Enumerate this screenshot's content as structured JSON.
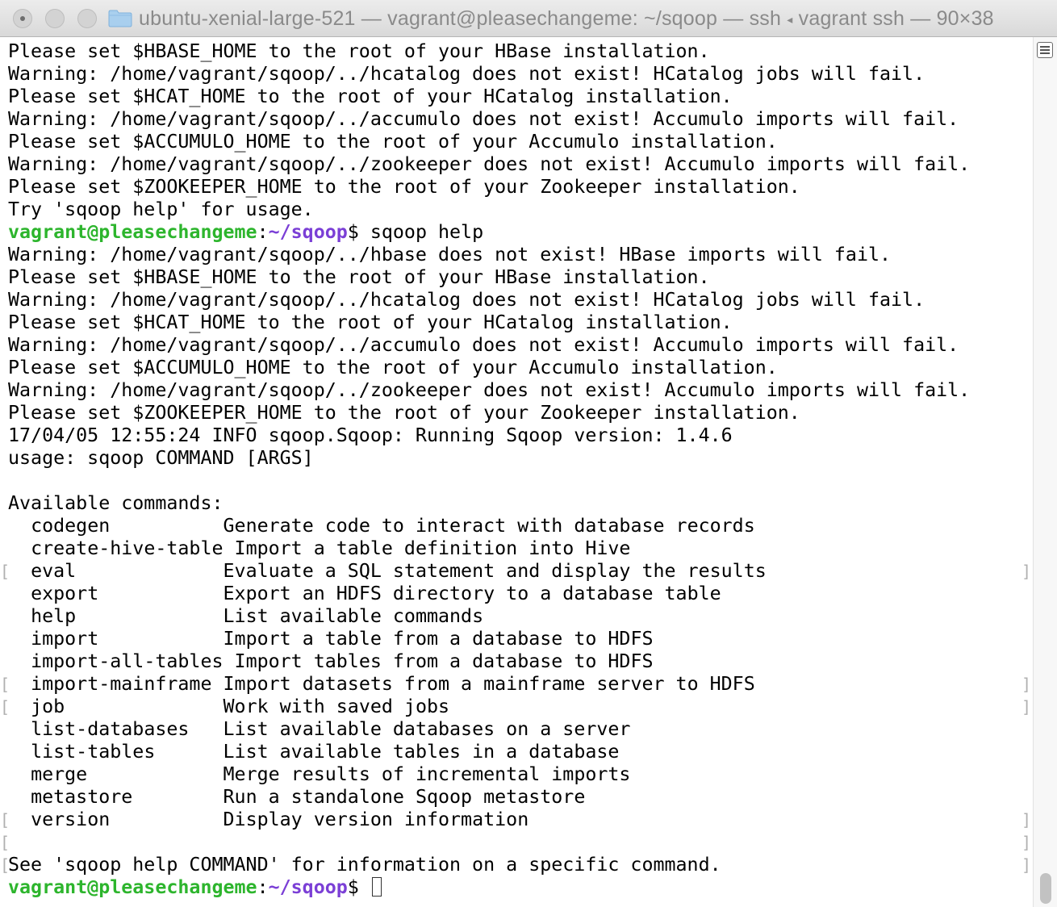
{
  "window": {
    "title": "ubuntu-xenial-large-521 — vagrant@pleasechangeme: ~/sqoop — ssh",
    "title_arrow": "◂",
    "title_suffix": "vagrant ssh — 90×38"
  },
  "prompt": {
    "user_host": "vagrant@pleasechangeme",
    "colon": ":",
    "path": "~/sqoop",
    "dollar": "$",
    "command": " sqoop help"
  },
  "lines_before": [
    "Please set $HBASE_HOME to the root of your HBase installation.",
    "Warning: /home/vagrant/sqoop/../hcatalog does not exist! HCatalog jobs will fail.",
    "Please set $HCAT_HOME to the root of your HCatalog installation.",
    "Warning: /home/vagrant/sqoop/../accumulo does not exist! Accumulo imports will fail.",
    "Please set $ACCUMULO_HOME to the root of your Accumulo installation.",
    "Warning: /home/vagrant/sqoop/../zookeeper does not exist! Accumulo imports will fail.",
    "Please set $ZOOKEEPER_HOME to the root of your Zookeeper installation.",
    "Try 'sqoop help' for usage."
  ],
  "lines_after": [
    "Warning: /home/vagrant/sqoop/../hbase does not exist! HBase imports will fail.",
    "Please set $HBASE_HOME to the root of your HBase installation.",
    "Warning: /home/vagrant/sqoop/../hcatalog does not exist! HCatalog jobs will fail.",
    "Please set $HCAT_HOME to the root of your HCatalog installation.",
    "Warning: /home/vagrant/sqoop/../accumulo does not exist! Accumulo imports will fail.",
    "Please set $ACCUMULO_HOME to the root of your Accumulo installation.",
    "Warning: /home/vagrant/sqoop/../zookeeper does not exist! Accumulo imports will fail.",
    "Please set $ZOOKEEPER_HOME to the root of your Zookeeper installation.",
    "17/04/05 12:55:24 INFO sqoop.Sqoop: Running Sqoop version: 1.4.6",
    "usage: sqoop COMMAND [ARGS]",
    "",
    "Available commands:"
  ],
  "commands": [
    {
      "name": "codegen",
      "desc": "Generate code to interact with database records"
    },
    {
      "name": "create-hive-table",
      "desc": "Import a table definition into Hive"
    },
    {
      "name": "eval",
      "desc": "Evaluate a SQL statement and display the results"
    },
    {
      "name": "export",
      "desc": "Export an HDFS directory to a database table"
    },
    {
      "name": "help",
      "desc": "List available commands"
    },
    {
      "name": "import",
      "desc": "Import a table from a database to HDFS"
    },
    {
      "name": "import-all-tables",
      "desc": "Import tables from a database to HDFS"
    },
    {
      "name": "import-mainframe",
      "desc": "Import datasets from a mainframe server to HDFS"
    },
    {
      "name": "job",
      "desc": "Work with saved jobs"
    },
    {
      "name": "list-databases",
      "desc": "List available databases on a server"
    },
    {
      "name": "list-tables",
      "desc": "List available tables in a database"
    },
    {
      "name": "merge",
      "desc": "Merge results of incremental imports"
    },
    {
      "name": "metastore",
      "desc": "Run a standalone Sqoop metastore"
    },
    {
      "name": "version",
      "desc": "Display version information"
    }
  ],
  "lines_end": [
    "",
    "See 'sqoop help COMMAND' for information on a specific command."
  ],
  "mark_glyphs": {
    "left": "[",
    "right": "]"
  },
  "colors": {
    "prompt_user": "#2db52d",
    "prompt_path": "#7b3fd6",
    "text": "#000000",
    "title_text": "#8a8a8a"
  },
  "icons": {
    "folder": "folder-icon",
    "split": "split-pane-icon"
  }
}
